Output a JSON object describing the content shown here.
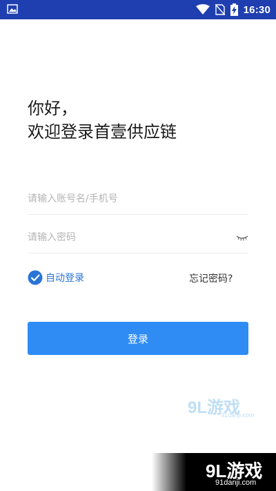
{
  "status_bar": {
    "time": "16:30",
    "icons": [
      "image-icon",
      "wifi-icon",
      "no-sim-icon",
      "battery-charging-icon"
    ]
  },
  "greeting": {
    "line1": "你好，",
    "line2": "欢迎登录首壹供应链"
  },
  "form": {
    "account_placeholder": "请输入账号名/手机号",
    "account_value": "",
    "password_placeholder": "请输入密码",
    "password_value": "",
    "auto_login_label": "自动登录",
    "auto_login_checked": true,
    "forgot_password_label": "忘记密码?",
    "login_button_label": "登录"
  },
  "watermark": {
    "logo_text": "9L游戏",
    "site_text": "91danji.com"
  },
  "colors": {
    "status_bar": "#1f3fb0",
    "primary_button": "#2e8cf4",
    "checkbox": "#2a74d8",
    "placeholder": "#b4b4b4"
  }
}
